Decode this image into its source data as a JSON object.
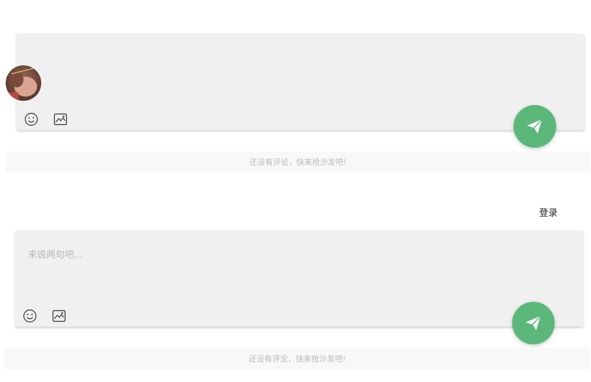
{
  "comment_section_1": {
    "input_value": "",
    "input_placeholder": "",
    "empty_message": "还没有评论，快来抢沙发吧!"
  },
  "comment_section_2": {
    "input_value": "",
    "input_placeholder": "来说两句吧...",
    "empty_message": "还没有评论，快来抢沙发吧!",
    "login_label": "登录"
  },
  "icons": {
    "emoji": "smile-icon",
    "image": "image-icon",
    "send": "paper-plane-icon"
  },
  "colors": {
    "send_button": "#5cb87a",
    "box_background": "#f0f0f0",
    "empty_bar_background": "#f8f8f8",
    "placeholder_text": "#b8b8b8"
  }
}
